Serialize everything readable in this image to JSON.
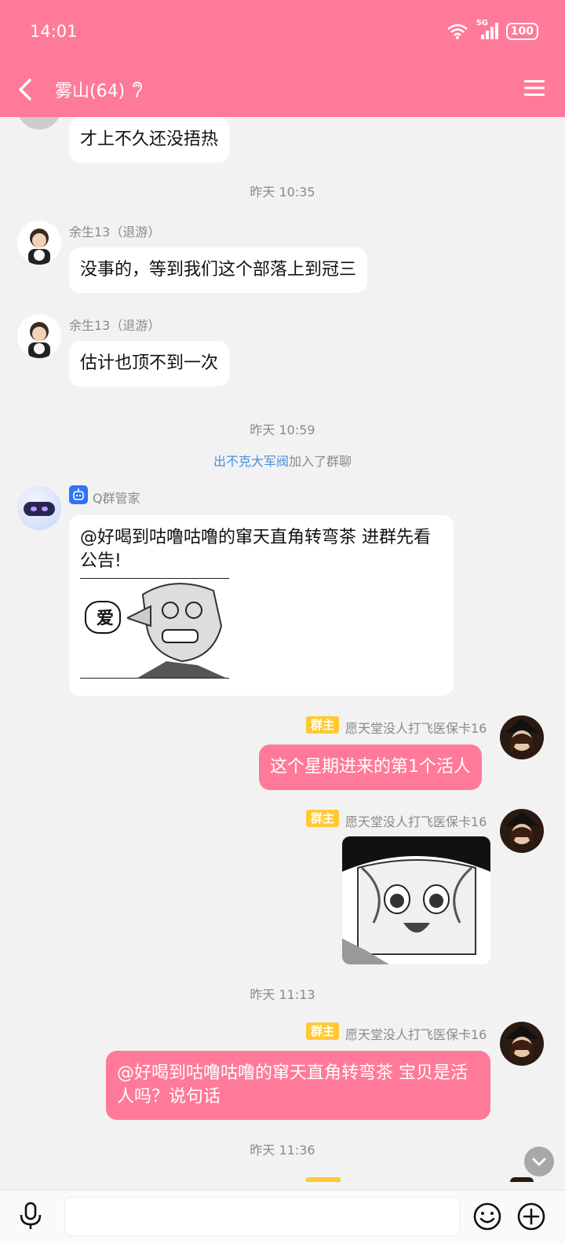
{
  "status_bar": {
    "time": "14:01",
    "network": "5G",
    "battery": "100"
  },
  "header": {
    "title": "雾山(64)"
  },
  "messages": {
    "m1": {
      "text": "才上不久还没捂热"
    },
    "t1": "昨天 10:35",
    "m2": {
      "sender": "余生13（退游）",
      "text": "没事的，等到我们这个部落上到冠三"
    },
    "m3": {
      "sender": "余生13（退游）",
      "text": "估计也顶不到一次"
    },
    "t2": "昨天 10:59",
    "sys1": {
      "user": "出不克大军阀",
      "action": "加入了群聊"
    },
    "m4": {
      "sender": "Q群管家",
      "text": "@好喝到咕噜咕噜的窜天直角转弯茶 进群先看公告!",
      "image_caption": "爱"
    },
    "m5": {
      "badge": "群主",
      "sender": "愿天堂没人打飞医保卡16",
      "text": "这个星期进来的第1个活人"
    },
    "m6": {
      "badge": "群主",
      "sender": "愿天堂没人打飞医保卡16"
    },
    "t3": "昨天 11:13",
    "m7": {
      "badge": "群主",
      "sender": "愿天堂没人打飞医保卡16",
      "text": "@好喝到咕噜咕噜的窜天直角转弯茶 宝贝是活人吗？说句话"
    },
    "t4": "昨天 11:36"
  },
  "colors": {
    "accent": "#ff7a98",
    "owner_badge": "#ffc934",
    "link": "#4a8fe0"
  }
}
